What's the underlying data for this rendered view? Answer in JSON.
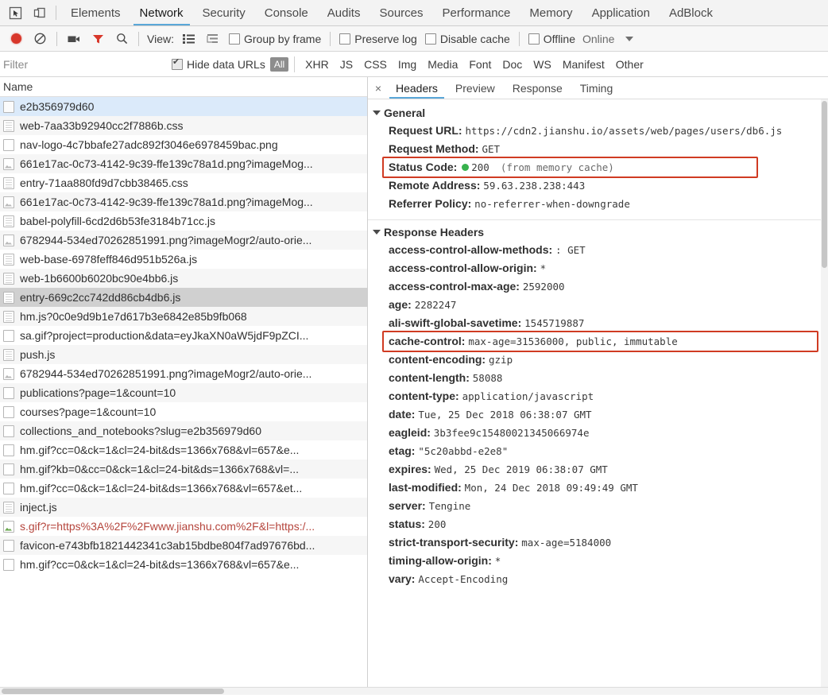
{
  "toolbar": {
    "inspect_icon": "inspect-element-icon",
    "device_icon": "device-toolbar-icon",
    "tabs": [
      {
        "label": "Elements",
        "active": false
      },
      {
        "label": "Network",
        "active": true
      },
      {
        "label": "Security",
        "active": false
      },
      {
        "label": "Console",
        "active": false
      },
      {
        "label": "Audits",
        "active": false
      },
      {
        "label": "Sources",
        "active": false
      },
      {
        "label": "Performance",
        "active": false
      },
      {
        "label": "Memory",
        "active": false
      },
      {
        "label": "Application",
        "active": false
      },
      {
        "label": "AdBlock",
        "active": false
      }
    ]
  },
  "network_toolbar": {
    "record_icon": "record-icon",
    "clear_icon": "clear-icon",
    "camera_icon": "camera-icon",
    "filter_icon": "filter-funnel-icon",
    "search_icon": "search-icon",
    "view_label": "View:",
    "list_view_icon": "list-view-icon",
    "waterfall_view_icon": "waterfall-view-icon",
    "group_by_frame": "Group by frame",
    "preserve_log": "Preserve log",
    "disable_cache": "Disable cache",
    "offline": "Offline",
    "online": "Online",
    "throttle_caret_icon": "chevron-down-icon"
  },
  "filter_bar": {
    "placeholder": "Filter",
    "value": "",
    "hide_data_urls": "Hide data URLs",
    "hide_data_urls_checked": true,
    "types": [
      {
        "label": "All",
        "selected": true
      },
      {
        "label": "XHR",
        "selected": false
      },
      {
        "label": "JS",
        "selected": false
      },
      {
        "label": "CSS",
        "selected": false
      },
      {
        "label": "Img",
        "selected": false
      },
      {
        "label": "Media",
        "selected": false
      },
      {
        "label": "Font",
        "selected": false
      },
      {
        "label": "Doc",
        "selected": false
      },
      {
        "label": "WS",
        "selected": false
      },
      {
        "label": "Manifest",
        "selected": false
      },
      {
        "label": "Other",
        "selected": false
      }
    ]
  },
  "request_list": {
    "column_header": "Name",
    "rows": [
      {
        "name": "e2b356979d60",
        "icon": "document-icon",
        "state": "focused"
      },
      {
        "name": "web-7aa33b92940cc2f7886b.css",
        "icon": "stylesheet-icon",
        "state": ""
      },
      {
        "name": "nav-logo-4c7bbafe27adc892f3046e6978459bac.png",
        "icon": "image-placeholder-icon",
        "state": ""
      },
      {
        "name": "661e17ac-0c73-4142-9c39-ffe139c78a1d.png?imageMog...",
        "icon": "image-icon",
        "state": ""
      },
      {
        "name": "entry-71aa880fd9d7cbb38465.css",
        "icon": "stylesheet-icon",
        "state": ""
      },
      {
        "name": "661e17ac-0c73-4142-9c39-ffe139c78a1d.png?imageMog...",
        "icon": "image-icon",
        "state": ""
      },
      {
        "name": "babel-polyfill-6cd2d6b53fe3184b71cc.js",
        "icon": "script-icon",
        "state": ""
      },
      {
        "name": "6782944-534ed70262851991.png?imageMogr2/auto-orie...",
        "icon": "image-icon",
        "state": ""
      },
      {
        "name": "web-base-6978feff846d951b526a.js",
        "icon": "script-icon",
        "state": ""
      },
      {
        "name": "web-1b6600b6020bc90e4bb6.js",
        "icon": "script-icon",
        "state": ""
      },
      {
        "name": "entry-669c2cc742dd86cb4db6.js",
        "icon": "script-icon",
        "state": "selected"
      },
      {
        "name": "hm.js?0c0e9d9b1e7d617b3e6842e85b9fb068",
        "icon": "script-icon",
        "state": ""
      },
      {
        "name": "sa.gif?project=production&data=eyJkaXN0aW5jdF9pZCI...",
        "icon": "image-placeholder-icon",
        "state": ""
      },
      {
        "name": "push.js",
        "icon": "script-icon",
        "state": ""
      },
      {
        "name": "6782944-534ed70262851991.png?imageMogr2/auto-orie...",
        "icon": "image-icon",
        "state": ""
      },
      {
        "name": "publications?page=1&count=10",
        "icon": "xhr-icon",
        "state": ""
      },
      {
        "name": "courses?page=1&count=10",
        "icon": "xhr-icon",
        "state": ""
      },
      {
        "name": "collections_and_notebooks?slug=e2b356979d60",
        "icon": "xhr-icon",
        "state": ""
      },
      {
        "name": "hm.gif?cc=0&ck=1&cl=24-bit&ds=1366x768&vl=657&e...",
        "icon": "image-placeholder-icon",
        "state": ""
      },
      {
        "name": "hm.gif?kb=0&cc=0&ck=1&cl=24-bit&ds=1366x768&vl=...",
        "icon": "image-placeholder-icon",
        "state": ""
      },
      {
        "name": "hm.gif?cc=0&ck=1&cl=24-bit&ds=1366x768&vl=657&et...",
        "icon": "image-placeholder-icon",
        "state": ""
      },
      {
        "name": "inject.js",
        "icon": "script-icon",
        "state": ""
      },
      {
        "name": "s.gif?r=https%3A%2F%2Fwww.jianshu.com%2F&l=https:/...",
        "icon": "image-icon-color",
        "state": "failed"
      },
      {
        "name": "favicon-e743bfb1821442341c3ab15bdbe804f7ad97676bd...",
        "icon": "image-placeholder-icon",
        "state": ""
      },
      {
        "name": "hm.gif?cc=0&ck=1&cl=24-bit&ds=1366x768&vl=657&e...",
        "icon": "image-placeholder-icon",
        "state": ""
      }
    ]
  },
  "detail_panel": {
    "close_icon": "close-icon",
    "tabs": [
      {
        "label": "Headers",
        "active": true
      },
      {
        "label": "Preview",
        "active": false
      },
      {
        "label": "Response",
        "active": false
      },
      {
        "label": "Timing",
        "active": false
      }
    ],
    "general": {
      "title": "General",
      "rows": [
        {
          "key": "Request URL:",
          "value": "https://cdn2.jianshu.io/assets/web/pages/users/db6.js",
          "highlight": false
        },
        {
          "key": "Request Method:",
          "value": "GET",
          "highlight": false
        },
        {
          "key": "Status Code:",
          "value": "200",
          "suffix": "(from memory cache)",
          "status_dot": "#37b24d",
          "highlight": true
        },
        {
          "key": "Remote Address:",
          "value": "59.63.238.238:443",
          "highlight": false
        },
        {
          "key": "Referrer Policy:",
          "value": "no-referrer-when-downgrade",
          "highlight": false
        }
      ]
    },
    "response_headers": {
      "title": "Response Headers",
      "rows": [
        {
          "key": "access-control-allow-methods:",
          "value": ": GET",
          "highlight": false
        },
        {
          "key": "access-control-allow-origin:",
          "value": "*",
          "highlight": false
        },
        {
          "key": "access-control-max-age:",
          "value": "2592000",
          "highlight": false
        },
        {
          "key": "age:",
          "value": "2282247",
          "highlight": false
        },
        {
          "key": "ali-swift-global-savetime:",
          "value": "1545719887",
          "highlight": false
        },
        {
          "key": "cache-control:",
          "value": "max-age=31536000, public, immutable",
          "highlight": true
        },
        {
          "key": "content-encoding:",
          "value": "gzip",
          "highlight": false
        },
        {
          "key": "content-length:",
          "value": "58088",
          "highlight": false
        },
        {
          "key": "content-type:",
          "value": "application/javascript",
          "highlight": false
        },
        {
          "key": "date:",
          "value": "Tue, 25 Dec 2018 06:38:07 GMT",
          "highlight": false
        },
        {
          "key": "eagleid:",
          "value": "3b3fee9c15480021345066974e",
          "highlight": false
        },
        {
          "key": "etag:",
          "value": "\"5c20abbd-e2e8\"",
          "highlight": false
        },
        {
          "key": "expires:",
          "value": "Wed, 25 Dec 2019 06:38:07 GMT",
          "highlight": false
        },
        {
          "key": "last-modified:",
          "value": "Mon, 24 Dec 2018 09:49:49 GMT",
          "highlight": false
        },
        {
          "key": "server:",
          "value": "Tengine",
          "highlight": false
        },
        {
          "key": "status:",
          "value": "200",
          "highlight": false
        },
        {
          "key": "strict-transport-security:",
          "value": "max-age=5184000",
          "highlight": false
        },
        {
          "key": "timing-allow-origin:",
          "value": "*",
          "highlight": false
        },
        {
          "key": "vary:",
          "value": "Accept-Encoding",
          "highlight": false
        }
      ]
    }
  },
  "colors": {
    "accent": "#5aa7d8",
    "highlight_box": "#d03b23",
    "status_ok": "#37b24d",
    "failed_text": "#b5453c",
    "record_active": "#d8372b"
  }
}
